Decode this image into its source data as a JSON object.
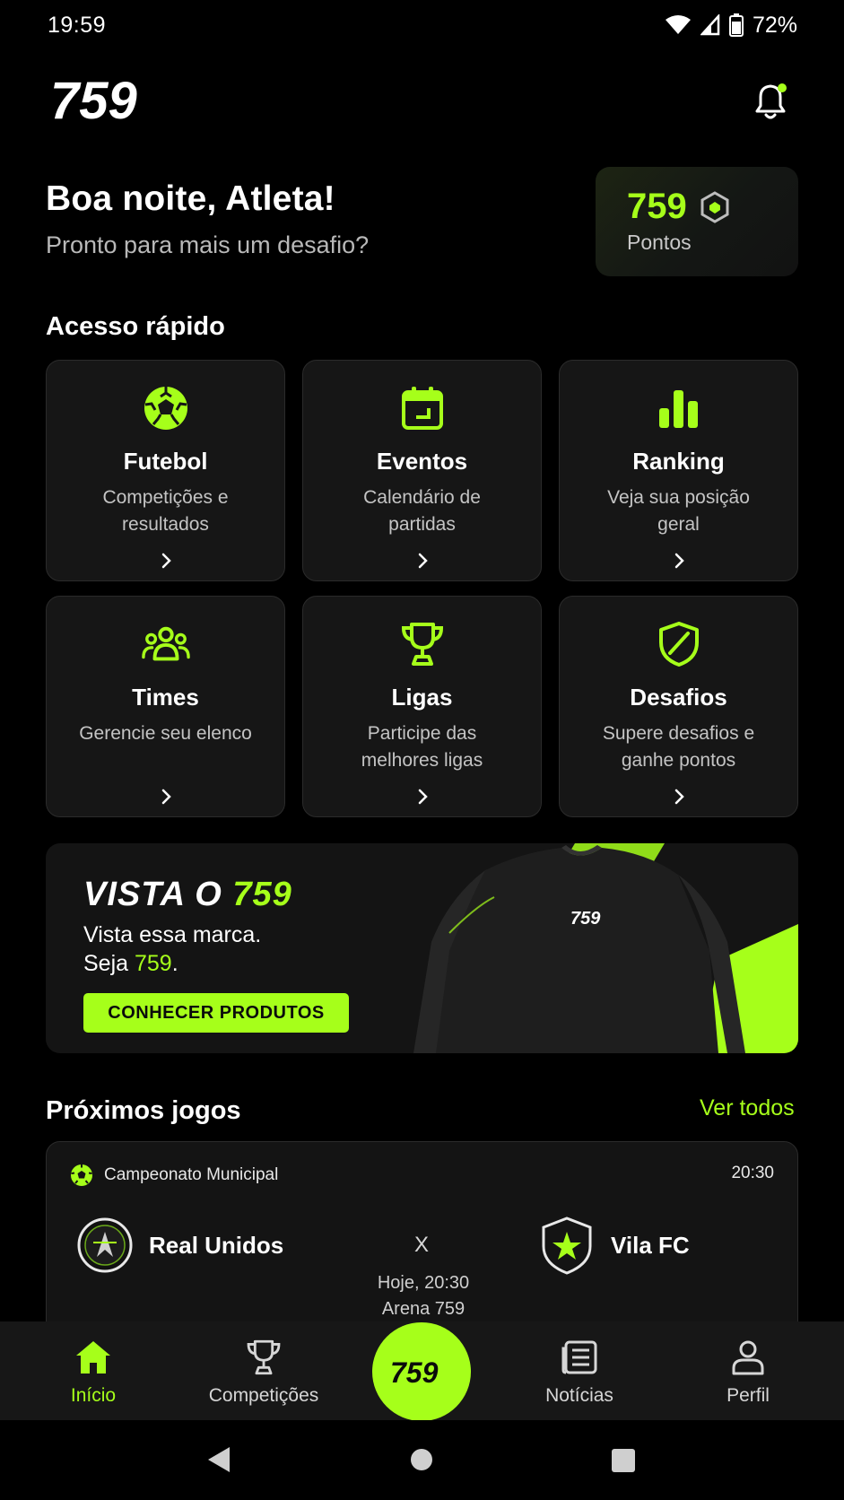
{
  "status_bar": {
    "time": "19:59",
    "battery": "72%"
  },
  "header": {
    "logo_text": "759"
  },
  "greeting": {
    "title": "Boa noite, Atleta!",
    "subtitle": "Pronto para mais um desafio?"
  },
  "points": {
    "value": "759",
    "label": "Pontos"
  },
  "quick_access": {
    "title": "Acesso rápido",
    "items": [
      {
        "title": "Futebol",
        "desc": "Competições e resultados",
        "icon": "soccer-ball-icon"
      },
      {
        "title": "Eventos",
        "desc": "Calendário de partidas",
        "icon": "calendar-icon"
      },
      {
        "title": "Ranking",
        "desc": "Veja sua posição geral",
        "icon": "bar-chart-icon"
      },
      {
        "title": "Times",
        "desc": "Gerencie seu elenco",
        "icon": "team-icon"
      },
      {
        "title": "Ligas",
        "desc": "Participe das melhores ligas",
        "icon": "trophy-icon"
      },
      {
        "title": "Desafios",
        "desc": "Supere desafios e ganhe pontos",
        "icon": "shield-icon"
      }
    ]
  },
  "banner": {
    "title_prefix": "VISTA O ",
    "title_brand": "759",
    "line1": "Vista essa marca.",
    "line2_prefix": "Seja ",
    "line2_brand": "759",
    "line2_suffix": ".",
    "button": "CONHECER PRODUTOS",
    "shirt_logo": "759"
  },
  "next_games": {
    "title": "Próximos jogos",
    "see_all": "Ver todos",
    "match": {
      "competition": "Campeonato Municipal",
      "time": "20:30",
      "home": "Real Unidos",
      "away": "Vila FC",
      "vs": "X",
      "date": "Hoje, 20:30",
      "venue": "Arena 759"
    }
  },
  "bottom_nav": {
    "items": [
      {
        "label": "Início",
        "icon": "home-icon"
      },
      {
        "label": "Competições",
        "icon": "trophy-icon"
      },
      {
        "label": "Notícias",
        "icon": "news-icon"
      },
      {
        "label": "Perfil",
        "icon": "profile-icon"
      }
    ],
    "center_label": "759"
  },
  "colors": {
    "accent": "#a6ff1a",
    "background": "#000000",
    "card": "#161616"
  }
}
